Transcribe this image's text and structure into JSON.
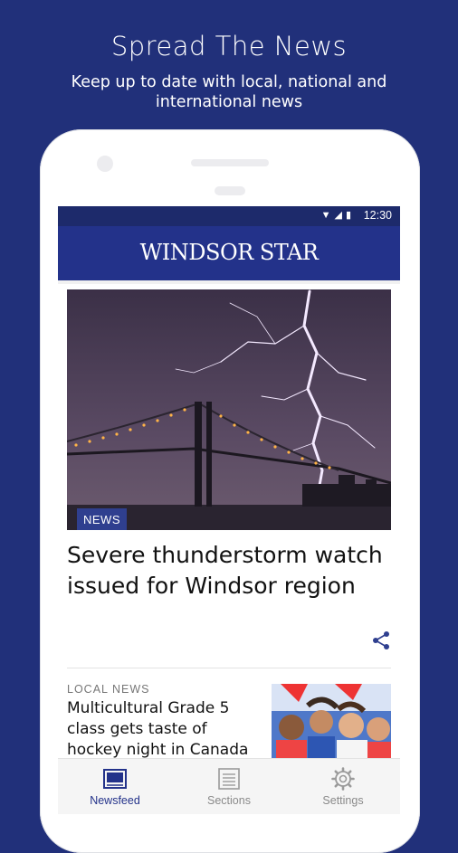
{
  "promo": {
    "title": "Spread The News",
    "subtitle": "Keep up to date with local, national and international news"
  },
  "status_bar": {
    "time": "12:30",
    "icons": [
      "wifi-icon",
      "signal-icon",
      "battery-icon"
    ]
  },
  "app": {
    "masthead": "WINDSOR STAR",
    "brand_color": "#23328a"
  },
  "feed": {
    "top_story": {
      "category": "NEWS",
      "headline": "Severe thunderstorm watch issued for Windsor region",
      "image": "lightning-bridge-photo"
    },
    "stories": [
      {
        "category": "LOCAL NEWS",
        "title": "Multicultural Grade 5 class gets taste of hockey night in Canada",
        "image": "students-photo"
      }
    ]
  },
  "nav": {
    "items": [
      {
        "label": "Newsfeed",
        "icon": "newsfeed-icon",
        "active": true
      },
      {
        "label": "Sections",
        "icon": "sections-icon",
        "active": false
      },
      {
        "label": "Settings",
        "icon": "settings-icon",
        "active": false
      }
    ]
  }
}
